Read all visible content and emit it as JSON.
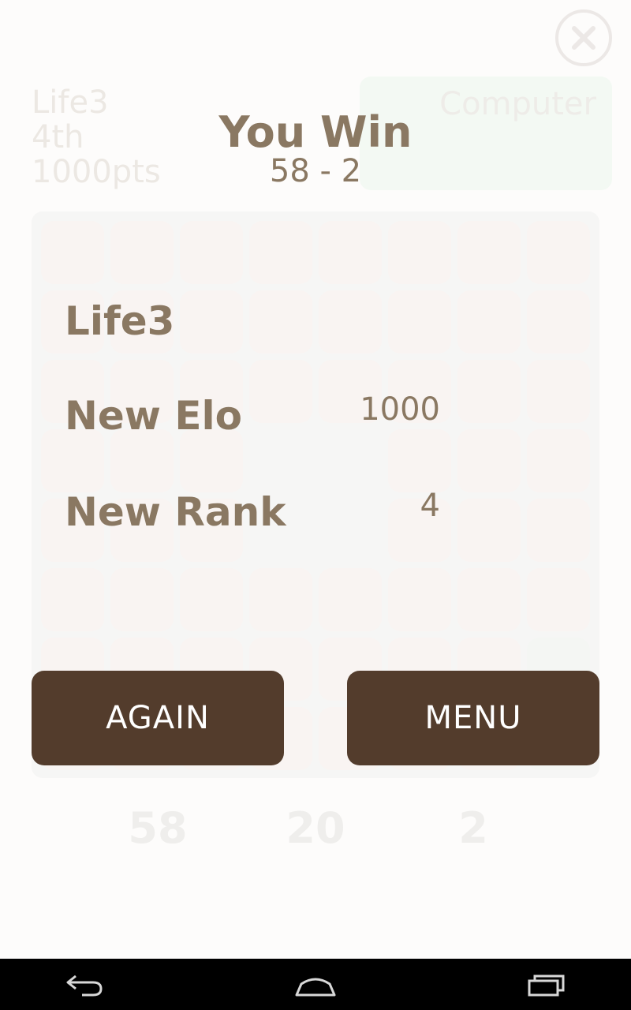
{
  "background": {
    "player": {
      "name": "Life3",
      "rank": "4th",
      "points": "1000pts"
    },
    "opponent": {
      "name": "Computer"
    },
    "scores": {
      "left": "58",
      "middle": "20",
      "right": "2"
    }
  },
  "result": {
    "title": "You Win",
    "score": "58 - 2",
    "player_name": "Life3",
    "elo_label": "New Elo",
    "elo_value": "1000",
    "rank_label": "New Rank",
    "rank_value": "4"
  },
  "buttons": {
    "again": "AGAIN",
    "menu": "MENU"
  },
  "icons": {
    "close": "close-icon",
    "back": "back-icon",
    "home": "home-icon",
    "recents": "recents-icon"
  },
  "colors": {
    "button_bg": "#533c2c",
    "text_brown": "#8a7862",
    "cell_pink": "#fdeeeb",
    "cell_green": "#eef6ee"
  }
}
